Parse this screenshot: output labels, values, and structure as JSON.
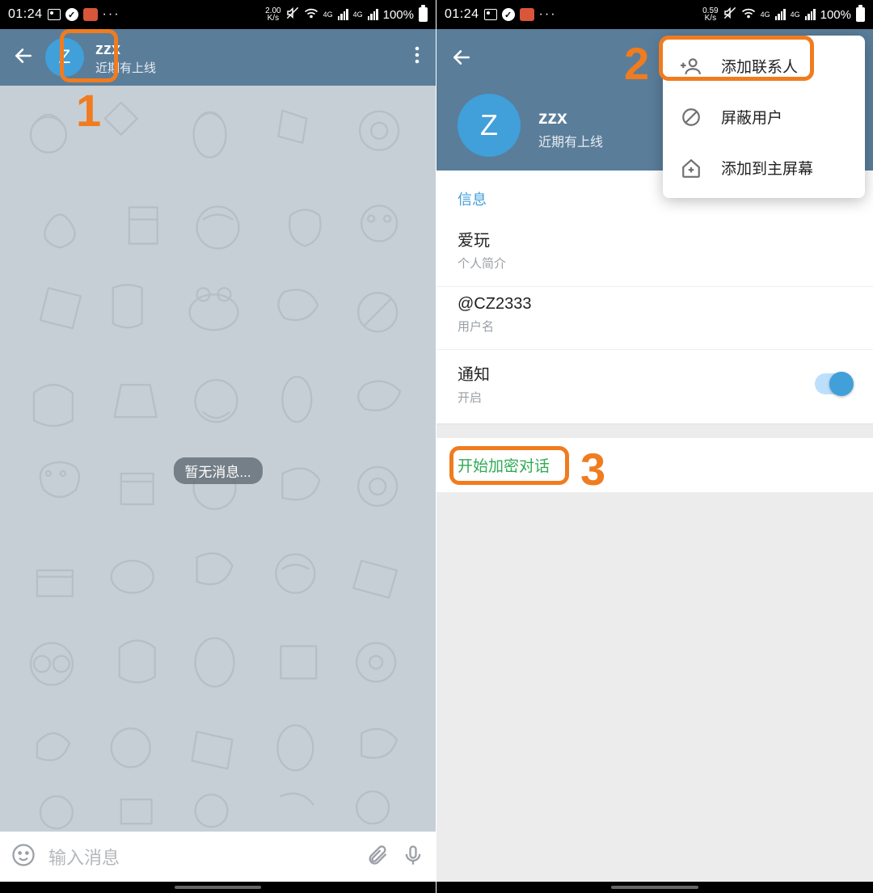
{
  "statusbar": {
    "time": "01:24",
    "kbs_left": "2.00",
    "kbs_right": "0.59",
    "kbs_unit": "K/s",
    "net_label": "4G",
    "battery": "100%"
  },
  "chat": {
    "avatar_letter": "Z",
    "title": "zzx",
    "subtitle": "近期有上线",
    "no_messages": "暂无消息...",
    "input_placeholder": "输入消息"
  },
  "profile": {
    "avatar_letter": "Z",
    "name": "zzx",
    "subtitle": "近期有上线",
    "section_label": "信息",
    "bio_value": "爱玩",
    "bio_label": "个人简介",
    "username_value": "@CZ2333",
    "username_label": "用户名",
    "notif_title": "通知",
    "notif_state": "开启",
    "secret_chat": "开始加密对话"
  },
  "menu": {
    "add_contact": "添加联系人",
    "block_user": "屏蔽用户",
    "add_home": "添加到主屏幕"
  },
  "annotations": {
    "n1": "1",
    "n2": "2",
    "n3": "3"
  }
}
